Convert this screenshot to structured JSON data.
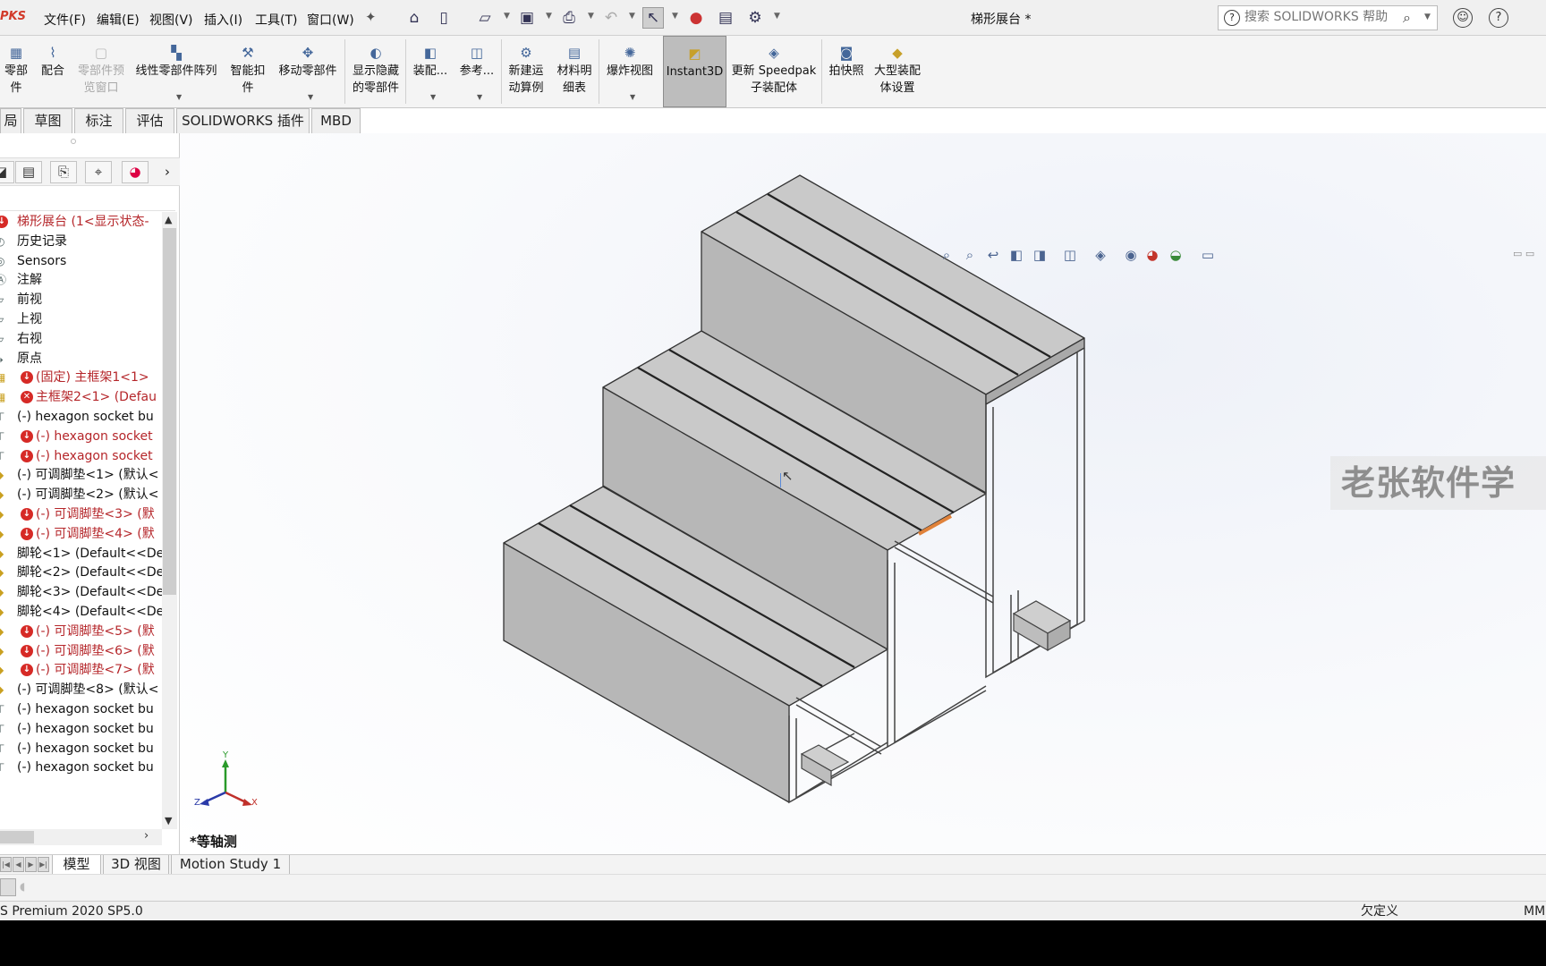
{
  "app": {
    "logo_text": "PKS",
    "document_title": "梯形展台 *"
  },
  "menu": [
    "文件(F)",
    "编辑(E)",
    "视图(V)",
    "插入(I)",
    "工具(T)",
    "窗口(W)"
  ],
  "quick_access_icons": [
    "home-icon",
    "new-document-icon",
    "open-icon",
    "save-icon",
    "print-icon",
    "undo-icon",
    "select-cursor-icon",
    "traffic-light-icon",
    "file-properties-icon",
    "options-gear-icon"
  ],
  "search": {
    "placeholder": "搜索 SOLIDWORKS 帮助"
  },
  "ribbon": {
    "insert_component": "零部件",
    "mate": "配合",
    "component_preview": [
      "零部件预",
      "览窗口"
    ],
    "linear_pattern": "线性零部件阵列",
    "smart_fasteners": [
      "智能扣",
      "件"
    ],
    "move_component": "移动零部件",
    "show_hidden": [
      "显示隐藏",
      "的零部件"
    ],
    "assembly_features": "装配...",
    "reference_geometry": "参考...",
    "new_motion_study": [
      "新建运",
      "动算例"
    ],
    "bom": [
      "材料明",
      "细表"
    ],
    "exploded_view": "爆炸视图",
    "instant3d": "Instant3D",
    "update_speedpak": [
      "更新 Speedpak",
      "子装配体"
    ],
    "snapshot": "拍快照",
    "large_assembly": [
      "大型装配",
      "体设置"
    ]
  },
  "command_tabs": [
    "局",
    "草图",
    "标注",
    "评估",
    "SOLIDWORKS 插件",
    "MBD"
  ],
  "feature_tree": [
    {
      "text": "梯形展台  (1<显示状态-",
      "icon": "assembly-icon",
      "badge": "",
      "red": true,
      "root": true
    },
    {
      "text": "历史记录",
      "icon": "history-icon",
      "badge": "",
      "red": false
    },
    {
      "text": "Sensors",
      "icon": "sensors-icon",
      "badge": "",
      "red": false
    },
    {
      "text": "注解",
      "icon": "annotations-icon",
      "badge": "",
      "red": false
    },
    {
      "text": "前视",
      "icon": "plane-icon",
      "badge": "",
      "red": false
    },
    {
      "text": "上视",
      "icon": "plane-icon",
      "badge": "",
      "red": false
    },
    {
      "text": "右视",
      "icon": "plane-icon",
      "badge": "",
      "red": false
    },
    {
      "text": "原点",
      "icon": "origin-icon",
      "badge": "",
      "red": false
    },
    {
      "text": "(固定) 主框架1<1>",
      "icon": "subassembly-icon",
      "badge": "down",
      "red": true
    },
    {
      "text": "主框架2<1> (Defau",
      "icon": "subassembly-icon",
      "badge": "x",
      "red": true
    },
    {
      "text": "(-) hexagon socket bu",
      "icon": "bolt-icon",
      "badge": "",
      "red": false
    },
    {
      "text": "(-) hexagon socket",
      "icon": "bolt-icon",
      "badge": "down",
      "red": true
    },
    {
      "text": "(-) hexagon socket",
      "icon": "bolt-icon",
      "badge": "down",
      "red": true
    },
    {
      "text": "(-) 可调脚垫<1> (默认<",
      "icon": "part-icon",
      "badge": "",
      "red": false
    },
    {
      "text": "(-) 可调脚垫<2> (默认<",
      "icon": "part-icon",
      "badge": "",
      "red": false
    },
    {
      "text": "(-) 可调脚垫<3> (默",
      "icon": "part-icon",
      "badge": "down",
      "red": true
    },
    {
      "text": "(-) 可调脚垫<4> (默",
      "icon": "part-icon",
      "badge": "down",
      "red": true
    },
    {
      "text": "脚轮<1> (Default<<De",
      "icon": "part-icon",
      "badge": "",
      "red": false
    },
    {
      "text": "脚轮<2> (Default<<De",
      "icon": "part-icon",
      "badge": "",
      "red": false
    },
    {
      "text": "脚轮<3> (Default<<De",
      "icon": "part-icon",
      "badge": "",
      "red": false
    },
    {
      "text": "脚轮<4> (Default<<De",
      "icon": "part-icon",
      "badge": "",
      "red": false
    },
    {
      "text": "(-) 可调脚垫<5> (默",
      "icon": "part-icon",
      "badge": "down",
      "red": true
    },
    {
      "text": "(-) 可调脚垫<6> (默",
      "icon": "part-icon",
      "badge": "down",
      "red": true
    },
    {
      "text": "(-) 可调脚垫<7> (默",
      "icon": "part-icon",
      "badge": "down",
      "red": true
    },
    {
      "text": "(-) 可调脚垫<8> (默认<",
      "icon": "part-icon",
      "badge": "",
      "red": false
    },
    {
      "text": "(-) hexagon socket bu",
      "icon": "bolt-icon",
      "badge": "",
      "red": false
    },
    {
      "text": "(-) hexagon socket bu",
      "icon": "bolt-icon",
      "badge": "",
      "red": false
    },
    {
      "text": "(-) hexagon socket bu",
      "icon": "bolt-icon",
      "badge": "",
      "red": false
    },
    {
      "text": "(-) hexagon socket bu",
      "icon": "bolt-icon",
      "badge": "",
      "red": false
    }
  ],
  "viewport": {
    "view_label": "*等轴测",
    "watermark": "老张软件学"
  },
  "triad": {
    "x": "X",
    "y": "Y",
    "z": "Z"
  },
  "bottom_tabs": [
    "模型",
    "3D 视图",
    "Motion Study 1"
  ],
  "status": {
    "left": "S Premium 2020 SP5.0",
    "defined": "欠定义",
    "units": "MM"
  },
  "colors": {
    "accent_red": "#b5262a",
    "highlight_orange": "#e0823a",
    "instant3d_bg": "#bdbdbd"
  }
}
